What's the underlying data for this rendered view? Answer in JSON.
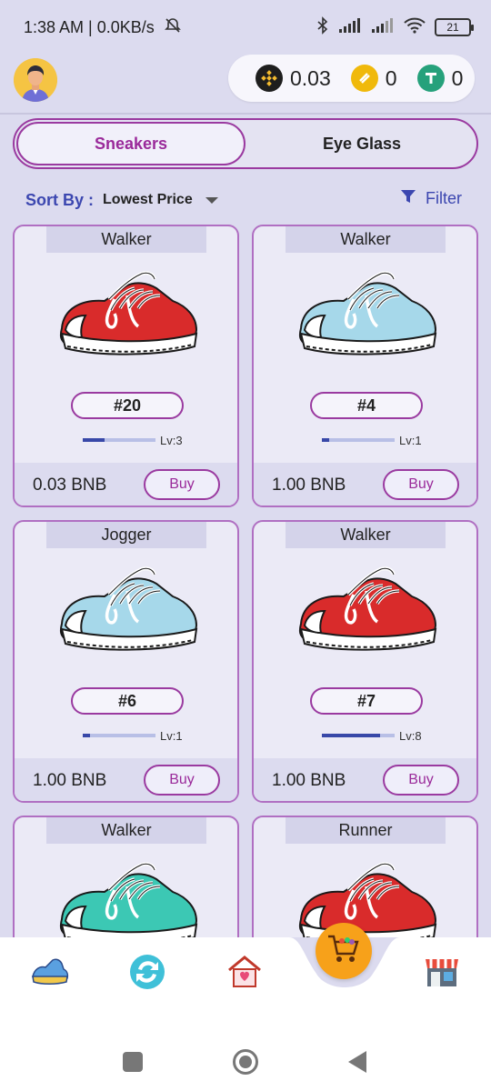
{
  "status_bar": {
    "time_net": "1:38 AM | 0.0KB/s",
    "battery": "21"
  },
  "wallet": {
    "bnb": "0.03",
    "busd": "0",
    "usdt": "0"
  },
  "tabs": [
    {
      "label": "Sneakers",
      "active": true
    },
    {
      "label": "Eye Glass",
      "active": false
    }
  ],
  "sort": {
    "label": "Sort By :",
    "value": "Lowest Price"
  },
  "filter": {
    "label": "Filter"
  },
  "cards": [
    {
      "type": "Walker",
      "id": "#20",
      "level_text": "Lv:3",
      "level": 3,
      "price": "0.03 BNB",
      "buy": "Buy",
      "color": "red"
    },
    {
      "type": "Walker",
      "id": "#4",
      "level_text": "Lv:1",
      "level": 1,
      "price": "1.00 BNB",
      "buy": "Buy",
      "color": "blue"
    },
    {
      "type": "Jogger",
      "id": "#6",
      "level_text": "Lv:1",
      "level": 1,
      "price": "1.00 BNB",
      "buy": "Buy",
      "color": "blue"
    },
    {
      "type": "Walker",
      "id": "#7",
      "level_text": "Lv:8",
      "level": 8,
      "price": "1.00 BNB",
      "buy": "Buy",
      "color": "red"
    },
    {
      "type": "Walker",
      "color": "teal"
    },
    {
      "type": "Runner",
      "color": "red"
    }
  ],
  "colors": {
    "accent": "#9a3aa0",
    "primary_blue": "#3c47b0",
    "background": "#dcdbef",
    "cart": "#f7a11a"
  },
  "bottom_nav": [
    {
      "icon": "sneaker-icon"
    },
    {
      "icon": "exchange-icon"
    },
    {
      "icon": "home-heart-icon"
    },
    {
      "icon": "cart-icon",
      "active": true
    },
    {
      "icon": "store-icon"
    }
  ]
}
